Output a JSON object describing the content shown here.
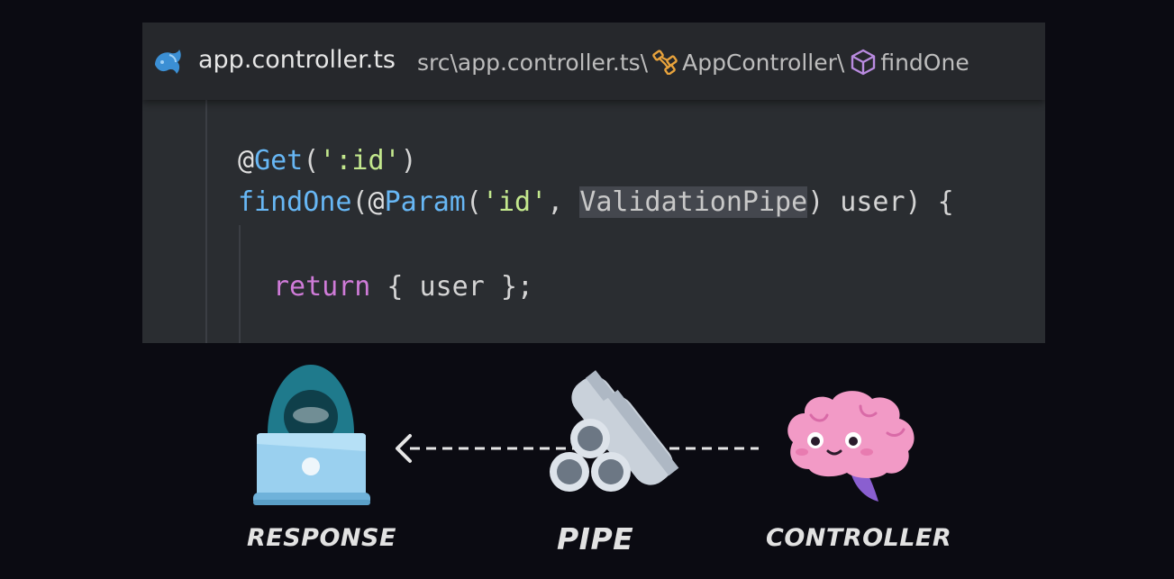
{
  "editor": {
    "filename": "app.controller.ts",
    "breadcrumb_path": "src\\app.controller.ts\\",
    "breadcrumb_class": "AppController\\",
    "breadcrumb_method": "findOne",
    "code": {
      "line1": {
        "at": "@",
        "decorator": "Get",
        "open": "(",
        "arg": "':id'",
        "close": ")"
      },
      "line2": {
        "name": "findOne",
        "open": "(",
        "at": "@",
        "decorator": "Param",
        "paren": "(",
        "arg": "'id'",
        "comma": ", ",
        "pipe": "ValidationPipe",
        "rest": ") user) {"
      },
      "line3": {
        "keyword": "return",
        "rest": " { user };"
      }
    }
  },
  "diagram": {
    "labels": {
      "response": "RESPONSE",
      "pipe": "PIPE",
      "controller": "CONTROLLER"
    }
  },
  "colors": {
    "background": "#0b0b12",
    "editor_bg": "#2a2d31",
    "function": "#67b7f5",
    "string": "#c3e88d",
    "keyword": "#cf7bd8",
    "class_icon": "#e8a33c",
    "method_icon": "#b98be0"
  }
}
